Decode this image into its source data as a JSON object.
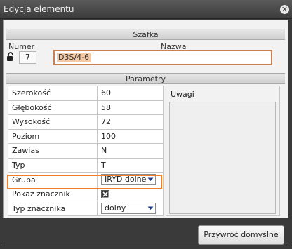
{
  "window": {
    "title": "Edycja elementu",
    "close_icon": "close-circle-icon"
  },
  "cabinet": {
    "section_title": "Szafka",
    "number_label": "Numer",
    "name_label": "Nazwa",
    "lock_icon": "lock-icon",
    "number_value": "7",
    "name_value": "D3S/4-6"
  },
  "params": {
    "section_title": "Parametry",
    "rows": [
      {
        "label": "Szerokość",
        "value": "60"
      },
      {
        "label": "Głębokość",
        "value": "58"
      },
      {
        "label": "Wysokość",
        "value": "72"
      },
      {
        "label": "Poziom",
        "value": "100"
      },
      {
        "label": "Zawias",
        "value": "N"
      },
      {
        "label": "Typ",
        "value": "T"
      },
      {
        "label": "Grupa",
        "value": "IRYD dolne"
      },
      {
        "label": "Pokaż znacznik",
        "checked": true
      },
      {
        "label": "Typ znacznika",
        "value": "dolny"
      }
    ],
    "notes_label": "Uwagi"
  },
  "footer": {
    "reset_label": "Przywróć domyślne"
  },
  "colors": {
    "highlight": "#ef7f2b",
    "name_selection": "#f3c9a6",
    "window_frame": "#3a3a3a"
  }
}
